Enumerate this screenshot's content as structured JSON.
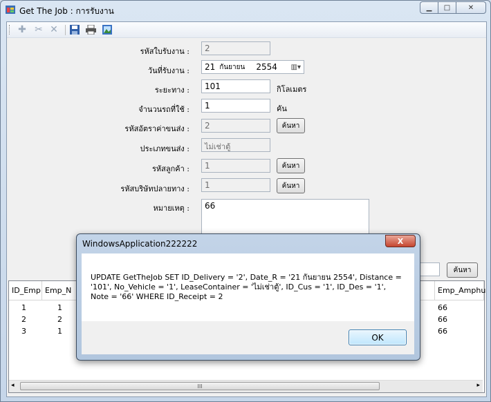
{
  "window": {
    "title": "Get The Job : การรับงาน"
  },
  "toolbar": {
    "icons": [
      "add-icon",
      "cut-icon",
      "delete-icon",
      "save-icon",
      "print-icon",
      "image-icon"
    ]
  },
  "form": {
    "receipt_id": {
      "label": "รหัสใบรับงาน :",
      "value": "2"
    },
    "date": {
      "label": "วันที่รับงาน :",
      "day": "21",
      "month": "กันยายน",
      "year": "2554"
    },
    "distance": {
      "label": "ระยะทาง :",
      "value": "101",
      "unit": "กิโลเมตร"
    },
    "vehicles": {
      "label": "จำนวนรถที่ใช้ :",
      "value": "1",
      "unit": "คัน"
    },
    "rate_code": {
      "label": "รหัสอัตราค่าขนส่ง :",
      "value": "2",
      "button": "ค้นหา"
    },
    "transport_type": {
      "label": "ประเภทขนส่ง :",
      "value": "ไม่เช่าตู้"
    },
    "customer_code": {
      "label": "รหัสลูกค้า :",
      "value": "1",
      "button": "ค้นหา"
    },
    "destination_code": {
      "label": "รหัสบริษัทปลายทาง :",
      "value": "1",
      "button": "ค้นหา"
    },
    "note": {
      "label": "หมายเหตุ :",
      "value": "66"
    },
    "search_button": "ค้นหา"
  },
  "grid": {
    "headers": [
      "ID_Emp",
      "Emp_N",
      "Emp_Amphu"
    ],
    "rows": [
      {
        "id": "1",
        "name": "1",
        "amphu": "66"
      },
      {
        "id": "2",
        "name": "2",
        "amphu": "66"
      },
      {
        "id": "3",
        "name": "1",
        "amphu": "66"
      }
    ],
    "scroll_thumb": "III"
  },
  "dialog": {
    "title": "WindowsApplication222222",
    "message": "UPDATE GetTheJob  SET ID_Delivery = '2', Date_R = '21 กันยายน 2554', Distance = '101', No_Vehicle = '1', LeaseContainer = 'ไม่เช่าตู้', ID_Cus = '1', ID_Des = '1', Note = '66' WHERE  ID_Receipt = 2",
    "ok": "OK",
    "close": "X"
  }
}
